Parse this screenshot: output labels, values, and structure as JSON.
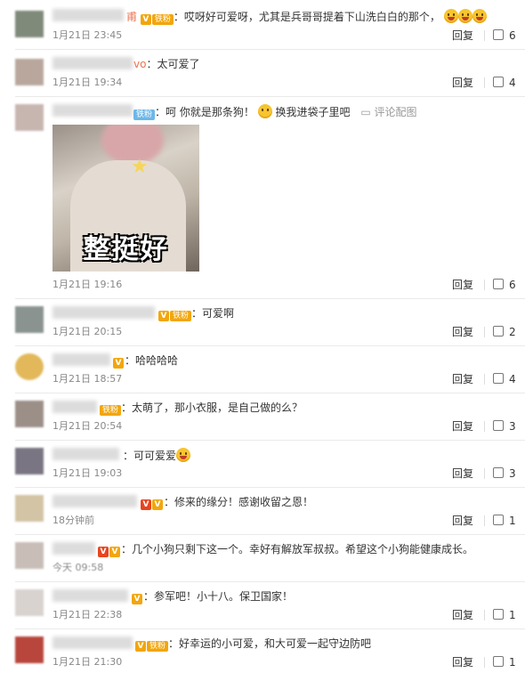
{
  "comments": [
    {
      "text": "：哎呀好可爱呀，尤其是兵哥哥提着下山洗白白的那个，",
      "badge": "铁粉",
      "user_tail": "甫",
      "time": "1月21日 23:45",
      "reply": "回复",
      "likes": "6"
    },
    {
      "text": "：太可爱了",
      "user_tail": "vo",
      "time": "1月21日 19:34",
      "reply": "回复",
      "likes": "4"
    },
    {
      "text": "：呵 你就是那条狗！",
      "text2": "换我进袋子里吧",
      "badge": "铁粉",
      "pic_link": "评论配图",
      "pic_caption": "整挺好",
      "time": "1月21日 19:16",
      "reply": "回复",
      "likes": "6"
    },
    {
      "text": "：可爱啊",
      "badge": "铁粉",
      "time": "1月21日 20:15",
      "reply": "回复",
      "likes": "2"
    },
    {
      "text": "：哈哈哈哈",
      "time": "1月21日 18:57",
      "reply": "回复",
      "likes": "4"
    },
    {
      "text": "：太萌了，那小衣服，是自己做的么？",
      "badge": "铁粉",
      "time": "1月21日 20:54",
      "reply": "回复",
      "likes": "3"
    },
    {
      "text": "：可可爱爱",
      "time": "1月21日 19:03",
      "reply": "回复",
      "likes": "3"
    },
    {
      "text": "：修来的缘分！感谢收留之恩！",
      "time": "18分钟前",
      "reply": "回复",
      "likes": "1"
    },
    {
      "text": "：几个小狗只剩下这一个。幸好有解放军叔叔。希望这个小狗能健康成长。",
      "time": "今天 09:58",
      "reply": "回复",
      "likes": "1"
    },
    {
      "text": "：参军吧！小十八。保卫国家！",
      "time": "1月21日 22:38",
      "reply": "回复",
      "likes": "1"
    },
    {
      "text": "：好幸运的小可爱，和大可爱一起守边防吧",
      "badge": "铁粉",
      "time": "1月21日 21:30",
      "reply": "回复",
      "likes": "1"
    }
  ],
  "icons": {
    "like": "thumb-up-icon",
    "emoji_grin": "grin-emoji-icon",
    "emoji_think": "thinking-emoji-icon",
    "vip": "vip-badge-icon",
    "picture": "picture-icon"
  }
}
